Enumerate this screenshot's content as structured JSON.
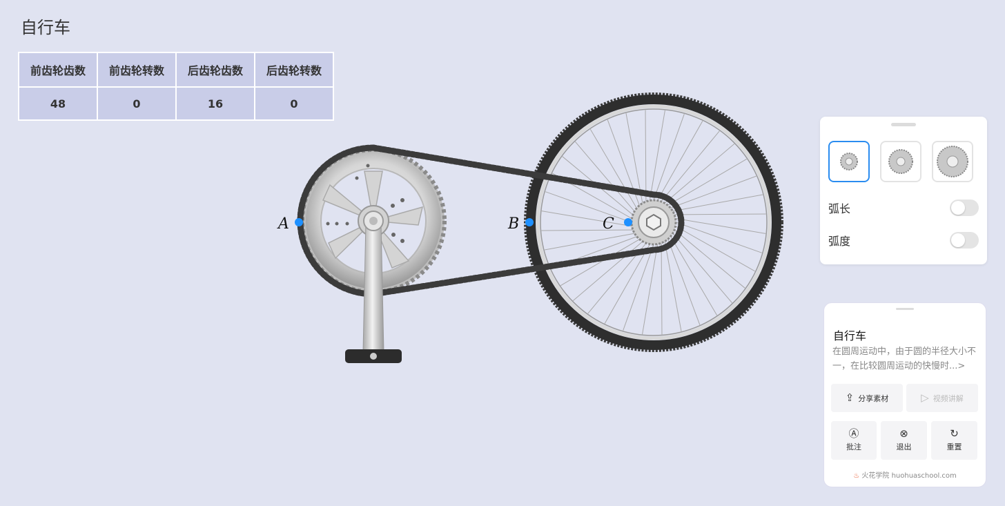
{
  "page": {
    "title": "自行车"
  },
  "table": {
    "headers": [
      "前齿轮齿数",
      "前齿轮转数",
      "后齿轮齿数",
      "后齿轮转数"
    ],
    "values": [
      "48",
      "0",
      "16",
      "0"
    ]
  },
  "scene": {
    "point_a": "A",
    "point_b": "B",
    "point_c": "C"
  },
  "settings": {
    "gear_options": [
      "small-gear-icon",
      "medium-gear-icon",
      "large-gear-icon"
    ],
    "selected_gear": 0,
    "arc_length_label": "弧长",
    "arc_length_on": false,
    "radian_label": "弧度",
    "radian_on": false
  },
  "info": {
    "title": "自行车",
    "description": "在圆周运动中，由于圆的半径大小不一，在比较圆周运动的快慢时...>",
    "share_label": "分享素材",
    "video_label": "视频讲解",
    "annotate_label": "批注",
    "exit_label": "退出",
    "reset_label": "重置",
    "brand": "火花学院 huohuaschool.com"
  },
  "colors": {
    "accent": "#2a8cf0",
    "background": "#e0e3f1",
    "point": "#1e90ff"
  }
}
